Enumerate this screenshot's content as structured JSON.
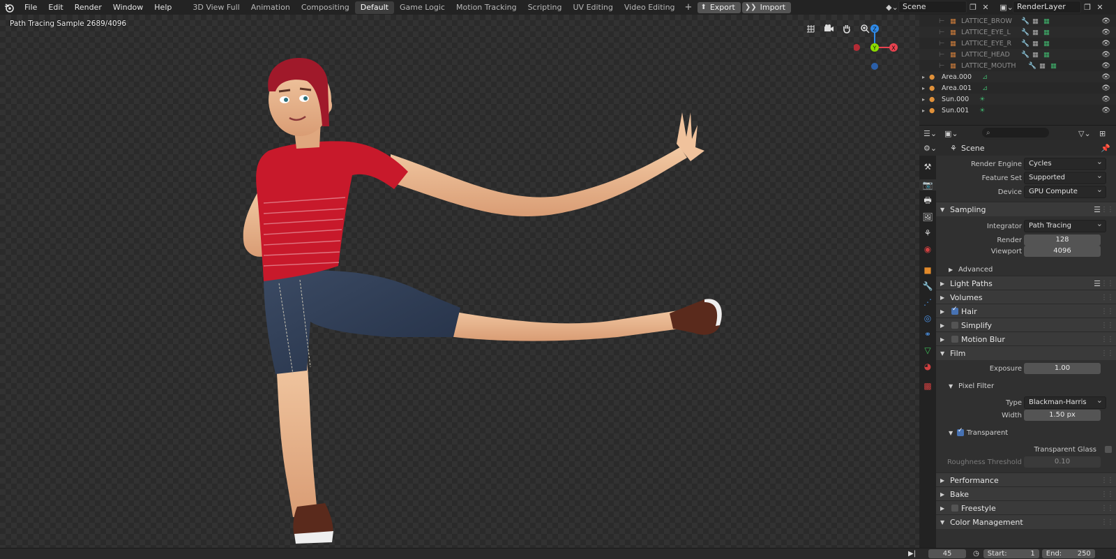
{
  "menu": [
    "File",
    "Edit",
    "Render",
    "Window",
    "Help"
  ],
  "workspaces": [
    "3D View Full",
    "Animation",
    "Compositing",
    "Default",
    "Game Logic",
    "Motion Tracking",
    "Scripting",
    "UV Editing",
    "Video Editing"
  ],
  "workspace_active": "Default",
  "add_workspace": "+",
  "export_label": "Export",
  "import_label": "Import",
  "scene_name": "Scene",
  "view_layer": "RenderLayer",
  "viewport": {
    "status": "Path Tracing Sample 2689/4096"
  },
  "gizmo": {
    "z": "Z",
    "y": "Y",
    "x": "X"
  },
  "outliner": {
    "rows": [
      {
        "label": "LATTICE_BROW",
        "dim": true
      },
      {
        "label": "LATTICE_EYE_L",
        "dim": true
      },
      {
        "label": "LATTICE_EYE_R",
        "dim": true
      },
      {
        "label": "LATTICE_HEAD",
        "dim": true
      },
      {
        "label": "LATTICE_MOUTH",
        "dim": true
      },
      {
        "label": "Area.000",
        "dim": false
      },
      {
        "label": "Area.001",
        "dim": false
      },
      {
        "label": "Sun.000",
        "dim": false
      },
      {
        "label": "Sun.001",
        "dim": false
      }
    ]
  },
  "properties": {
    "context": "Scene",
    "render_engine_label": "Render Engine",
    "render_engine": "Cycles",
    "feature_set_label": "Feature Set",
    "feature_set": "Supported",
    "device_label": "Device",
    "device": "GPU Compute",
    "sampling": "Sampling",
    "integrator_label": "Integrator",
    "integrator": "Path Tracing",
    "render_label": "Render",
    "render_samples": "128",
    "viewport_label": "Viewport",
    "viewport_samples": "4096",
    "advanced": "Advanced",
    "light_paths": "Light Paths",
    "volumes": "Volumes",
    "hair": "Hair",
    "simplify": "Simplify",
    "motion_blur": "Motion Blur",
    "film": "Film",
    "exposure_label": "Exposure",
    "exposure": "1.00",
    "pixel_filter": "Pixel Filter",
    "type_label": "Type",
    "filter_type": "Blackman-Harris",
    "width_label": "Width",
    "filter_width": "1.50 px",
    "transparent": "Transparent",
    "transparent_glass": "Transparent Glass",
    "roughness_label": "Roughness Threshold",
    "roughness": "0.10",
    "performance": "Performance",
    "bake": "Bake",
    "freestyle": "Freestyle",
    "color_management": "Color Management"
  },
  "timeline": {
    "frame": "45",
    "start_label": "Start:",
    "start": "1",
    "end_label": "End:",
    "end": "250"
  },
  "colors": {
    "accent": "#4772b3",
    "x_axis": "#e8424f",
    "y_axis": "#8bdc00",
    "z_axis": "#2f8bea",
    "shirt": "#c8192b"
  }
}
